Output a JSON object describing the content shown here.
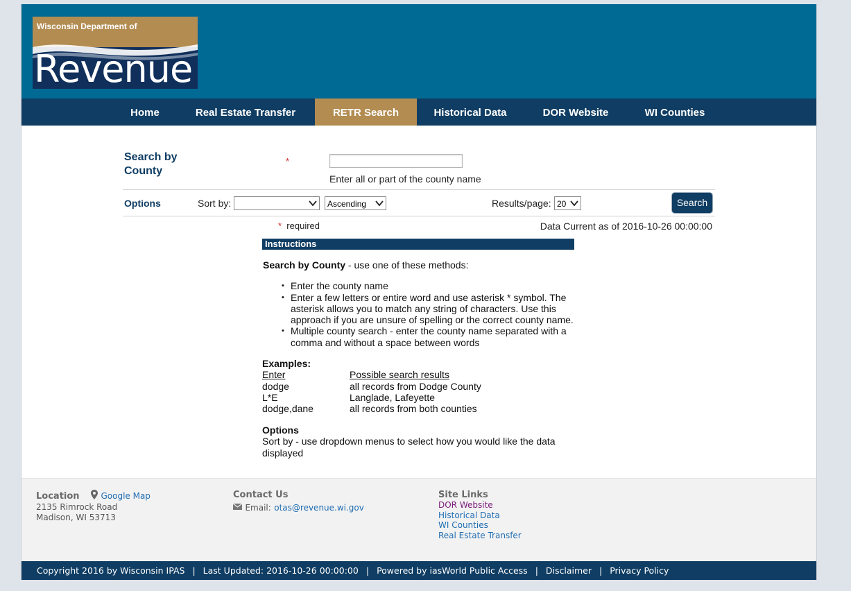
{
  "header": {
    "logo_top_text": "Wisconsin Department of",
    "logo_main_text": "Revenue",
    "colors": {
      "header_bg": "#006994",
      "nav_bg": "#103d63",
      "accent_gold": "#b38c52"
    }
  },
  "nav": {
    "items": [
      {
        "label": "Home"
      },
      {
        "label": "Real Estate Transfer"
      },
      {
        "label": "RETR Search",
        "active": true
      },
      {
        "label": "Historical Data"
      },
      {
        "label": "DOR Website"
      },
      {
        "label": "WI Counties"
      }
    ]
  },
  "search": {
    "title": "Search by County",
    "required_marker": "*",
    "county_value": "",
    "hint": "Enter all or part of the county name"
  },
  "options": {
    "label": "Options",
    "sort_by_label": "Sort by:",
    "sort_field_value": "",
    "sort_order_value": "Ascending",
    "results_per_page_label": "Results/page:",
    "results_per_page_value": "20",
    "search_button": "Search"
  },
  "status": {
    "required_marker": "*",
    "required_text": "required",
    "data_current": "Data Current as of 2016-10-26 00:00:00"
  },
  "instructions": {
    "header": "Instructions",
    "lead_bold": "Search by County",
    "lead_rest": " - use one of these methods:",
    "bullets": [
      "Enter the county name",
      "Enter a few letters or entire word and use asterisk * symbol. The asterisk allows you to match any string of characters. Use this approach if you are unsure of spelling or the correct county name.",
      "Multiple county search - enter the county name separated with a comma and without a space between words"
    ],
    "examples_title": "Examples:",
    "examples_header": {
      "enter": "Enter",
      "result": "Possible search results"
    },
    "examples": [
      {
        "enter": "dodge",
        "result": "all records from Dodge County"
      },
      {
        "enter": "L*E",
        "result": "Langlade, Lafeyette"
      },
      {
        "enter": "dodge,dane",
        "result": "all records from both counties"
      }
    ],
    "options_title": "Options",
    "options_text": "Sort by - use dropdown menus to select how you would like the data displayed"
  },
  "footer": {
    "location": {
      "heading": "Location",
      "map_link": "Google Map",
      "address_line1": "2135 Rimrock Road",
      "address_line2": "Madison, WI 53713"
    },
    "contact": {
      "heading": "Contact Us",
      "email_label": "Email:",
      "email": "otas@revenue.wi.gov"
    },
    "site_links": {
      "heading": "Site Links",
      "links": [
        "DOR Website",
        "Historical Data",
        "WI Counties",
        "Real Estate Transfer"
      ]
    }
  },
  "bottom_bar": {
    "copyright": "Copyright 2016 by Wisconsin IPAS",
    "last_updated": "Last Updated: 2016-10-26 00:00:00",
    "powered_by": "Powered by iasWorld Public Access",
    "disclaimer": "Disclaimer",
    "privacy": "Privacy Policy",
    "separator": "|"
  }
}
